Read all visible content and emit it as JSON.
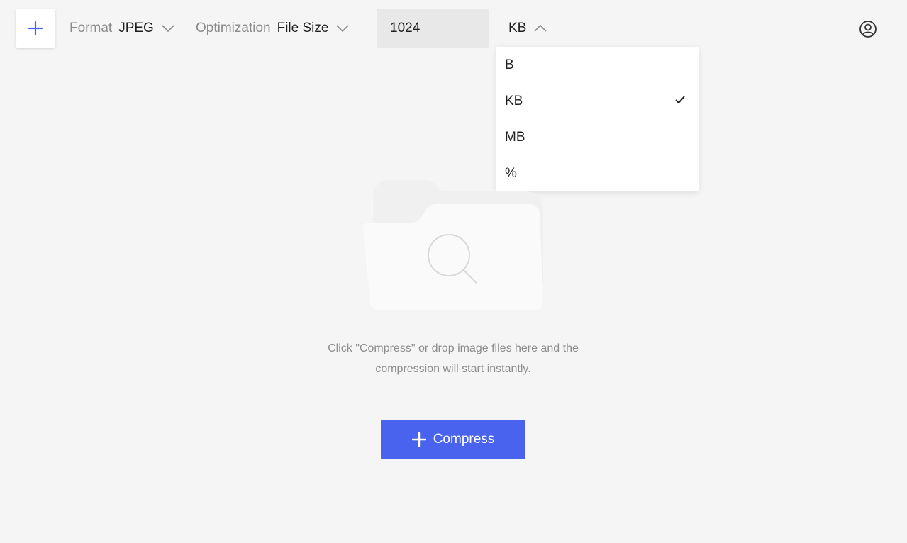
{
  "toolbar": {
    "add_icon": "plus-icon",
    "format": {
      "label": "Format",
      "value": "JPEG"
    },
    "optimization": {
      "label": "Optimization",
      "value": "File Size"
    },
    "size_value": "1024",
    "unit": {
      "value": "KB",
      "expanded": true
    },
    "user_icon": "user-circle-icon"
  },
  "unit_dropdown": {
    "options": [
      {
        "label": "B",
        "selected": false
      },
      {
        "label": "KB",
        "selected": true
      },
      {
        "label": "MB",
        "selected": false
      },
      {
        "label": "%",
        "selected": false
      }
    ]
  },
  "empty_state": {
    "icon": "folder-search-icon",
    "hint_line1": "Click \"Compress\" or drop image files here and the",
    "hint_line2": "compression will start instantly."
  },
  "compress_button": {
    "label": "Compress",
    "icon": "plus-icon"
  },
  "colors": {
    "background": "#f5f5f5",
    "accent": "#4a63ee",
    "input_bg": "#e8e8e8",
    "muted_text": "#8a8a8a"
  }
}
